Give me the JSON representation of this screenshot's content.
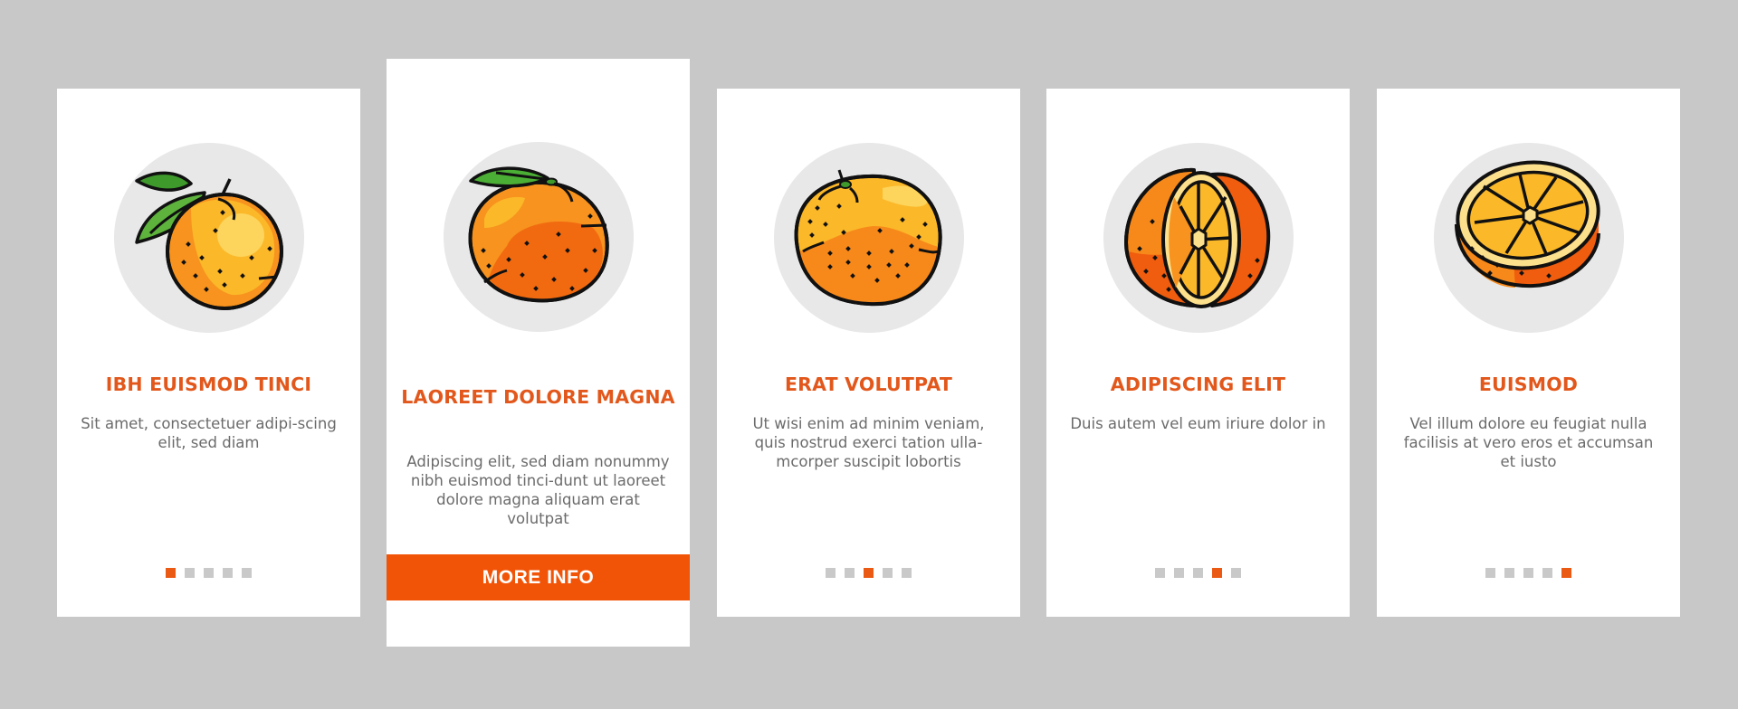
{
  "colors": {
    "background": "#c8c8c8",
    "card": "#ffffff",
    "accent": "#f25407",
    "title": "#e2581c",
    "body_text": "#6b6b6b",
    "dot_inactive": "#c9c9c9",
    "dot_active": "#ea5a14",
    "icon_circle": "#e8e8e8"
  },
  "cards": [
    {
      "illustration": "orange-with-leaves-icon",
      "title": "IBH EUISMOD TINCI",
      "description": "Sit amet, consectetuer adipi-scing elit, sed diam",
      "active_page": 1,
      "total_pages": 5
    },
    {
      "illustration": "tangerine-with-leaf-icon",
      "title": "LAOREET DOLORE MAGNA",
      "description": "Adipiscing elit, sed diam nonummy nibh euismod tinci-dunt ut laoreet dolore magna aliquam erat volutpat",
      "button_label": "MORE INFO"
    },
    {
      "illustration": "whole-orange-icon",
      "title": "ERAT VOLUTPAT",
      "description": "Ut wisi enim ad minim veniam, quis nostrud exerci tation ulla-mcorper suscipit lobortis",
      "active_page": 3,
      "total_pages": 5
    },
    {
      "illustration": "orange-with-slice-cut-icon",
      "title": "ADIPISCING ELIT",
      "description": "Duis autem vel eum iriure dolor in",
      "active_page": 4,
      "total_pages": 5
    },
    {
      "illustration": "orange-half-icon",
      "title": "EUISMOD",
      "description": "Vel illum dolore eu feugiat nulla facilisis at vero eros et accumsan et iusto",
      "active_page": 5,
      "total_pages": 5
    }
  ]
}
